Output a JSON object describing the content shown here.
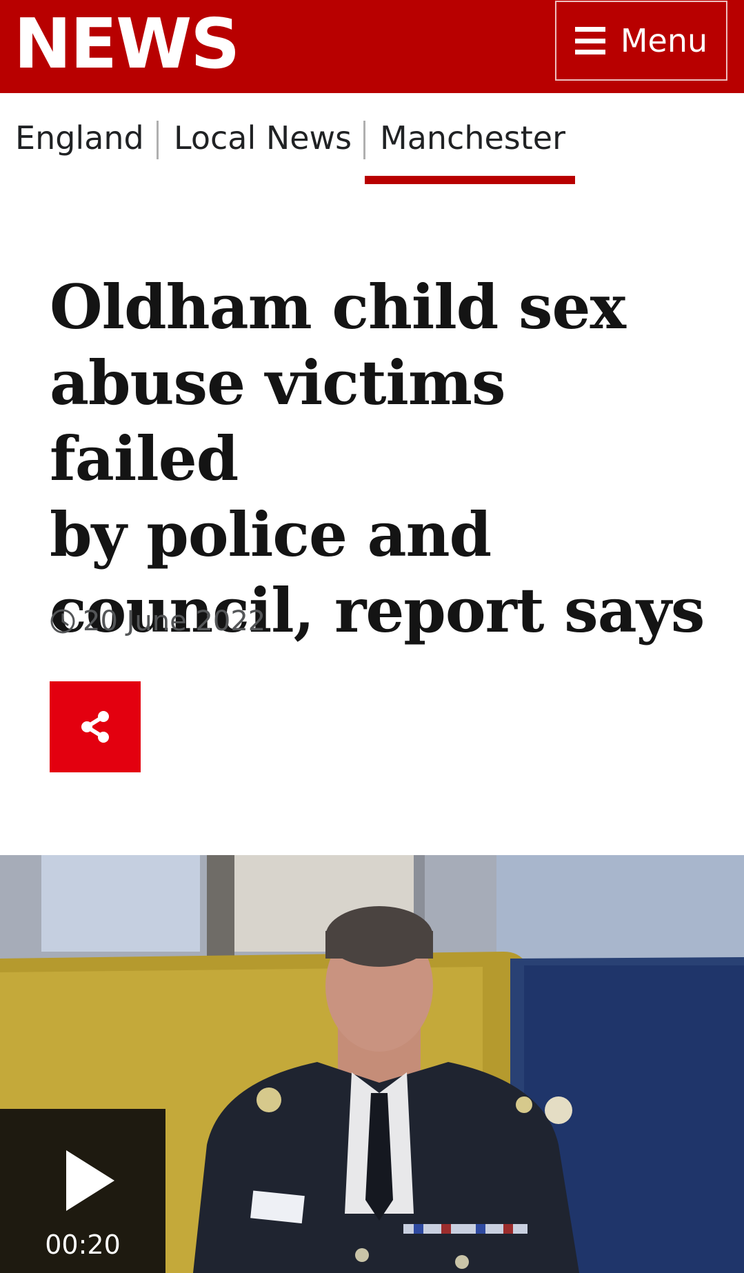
{
  "header": {
    "logo_text": "NEWS",
    "menu_label": "Menu",
    "brand_color": "#b80000"
  },
  "nav": {
    "items": [
      {
        "label": "England"
      },
      {
        "label": "Local News"
      },
      {
        "label": "Manchester",
        "active": true
      }
    ]
  },
  "article": {
    "headline_lines": [
      "Oldham child sex",
      "abuse victims failed",
      "by police and",
      "council, report says"
    ],
    "date": "20 June 2022",
    "share_icon": "share-icon",
    "share_color": "#e3000f"
  },
  "media": {
    "duration": "00:20",
    "play_icon": "play-icon"
  }
}
